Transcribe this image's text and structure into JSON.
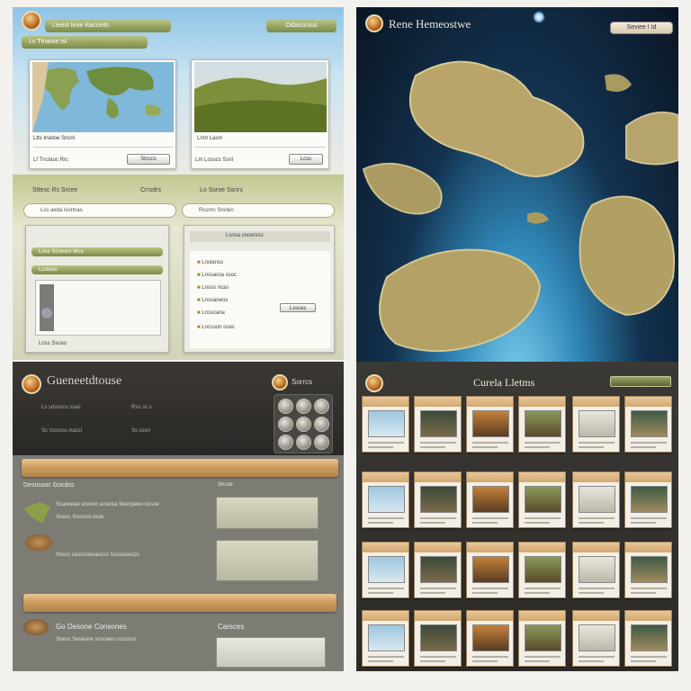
{
  "panel_a": {
    "title": "Lteest leoe Raccettc",
    "subtitle": "Ls Ttnaroe tsl",
    "top_button": "Odasscous",
    "card1": {
      "caption": "Ltts Irseloe Sncnl",
      "footer": "Lf  Tnctaoc Rrc",
      "button": "Stcccs"
    },
    "card2": {
      "caption": "Lrmt Lasm",
      "footer": "Lm  Losscs Ssnl",
      "button": "Lcss"
    }
  },
  "panel_b": {
    "title": "Rene Hemeostwe",
    "button": "Seviee I Id"
  },
  "panel_c": {
    "header_left": "Sttesc Rs Srcee",
    "header_mid": "Crrsdrs",
    "header_right": "Lo  Ssroe Ssnrs",
    "search_left": "Lss aeda lsonnas",
    "search_right": "Rssnrs    Snclen",
    "list_left_title": "Lnss Scnesro Wce",
    "list_left_sub": "Lcresss",
    "list_left_note": "Lnss Ssceo",
    "list_right_title": "Lsnsa sncenrss",
    "list_right_rows": [
      "Lnslanss",
      "Lnssaroa ssoc",
      "Lnsss ncas",
      "Lnssaneos",
      "Lnsscane",
      "Lncsson ocec"
    ],
    "list_right_button": "Lssces"
  },
  "panel_d": {
    "title": "Gueneetdtouse",
    "right_label": "Sorrcs",
    "row1_left": "Ls sdssscu ssas",
    "row1_right": "Rss  ss s",
    "row2_left": "Sc rscsnss Aaccl",
    "row2_right": "Ss  sssn",
    "section1_title": "Desnssoc Gocdss",
    "section1_text": "Scasneao  snceoc ecseoa  Seecpeeo ncsoe",
    "section1_text2": "Snesc  Ssscsro  esdc",
    "section1_right": "Sncse",
    "section1_note": "Snccc cesssnesaoccs  Sssosneccn",
    "section2_title": "Go Desone Consones",
    "section2_text": "Snesc Sesesne snsceeo  nccsscn",
    "section2_right": "Carsces"
  },
  "panel_e": {
    "title": "Curela Lletms",
    "button": ""
  }
}
